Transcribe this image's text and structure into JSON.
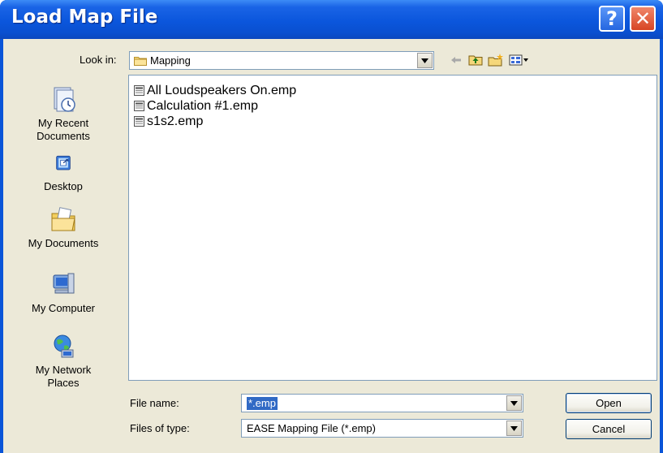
{
  "window": {
    "title": "Load Map File",
    "help_glyph": "?",
    "close_glyph": "✕"
  },
  "look_in": {
    "label": "Look in:",
    "value": "Mapping",
    "icon": "folder-icon"
  },
  "toolbar": {
    "icons": [
      "back-arrow-icon",
      "up-one-level-icon",
      "new-folder-icon",
      "view-menu-icon"
    ]
  },
  "places": [
    {
      "label": "My Recent\nDocuments",
      "icon": "recent-documents-icon"
    },
    {
      "label": "Desktop",
      "icon": "desktop-icon"
    },
    {
      "label": "My Documents",
      "icon": "my-documents-icon"
    },
    {
      "label": "My Computer",
      "icon": "my-computer-icon"
    },
    {
      "label": "My Network\nPlaces",
      "icon": "network-places-icon"
    }
  ],
  "files": [
    {
      "name": "All Loudspeakers On.emp",
      "icon": "emp-file-icon"
    },
    {
      "name": "Calculation #1.emp",
      "icon": "emp-file-icon"
    },
    {
      "name": "s1s2.emp",
      "icon": "emp-file-icon"
    }
  ],
  "file_name": {
    "label": "File name:",
    "value": "*.emp"
  },
  "files_of_type": {
    "label": "Files of type:",
    "value": "EASE Mapping File (*.emp)"
  },
  "buttons": {
    "open": "Open",
    "cancel": "Cancel"
  },
  "colors": {
    "titlebar": "#0a55d8",
    "selection": "#316ac5",
    "dialog_face": "#ece9d8",
    "close_button": "#d74524"
  }
}
